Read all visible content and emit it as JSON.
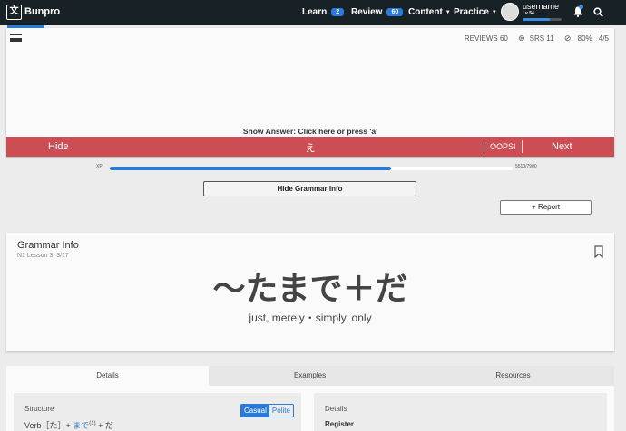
{
  "nav": {
    "logo_glyph": "文",
    "brand": "Bunpro",
    "learn_label": "Learn",
    "learn_count": "2",
    "review_label": "Review",
    "review_count": "60",
    "content_label": "Content",
    "practice_label": "Practice",
    "username": "username",
    "level": "Lv 54",
    "level_progress": 0.7
  },
  "review": {
    "reviews": "REVIEWS 60",
    "srs": "SRS 11",
    "accuracy": "80%",
    "progress": "4/5",
    "show_answer": "Show Answer: Click here or press 'a'",
    "hide_label": "Hide",
    "answer": "え",
    "oops_label": "OOPS!",
    "next_label": "Next"
  },
  "xp": {
    "label": "XP",
    "count": "5510/7900",
    "fraction": 0.6975
  },
  "buttons": {
    "hide_grammar": "Hide Grammar Info",
    "report": "+ Report"
  },
  "grammar": {
    "heading": "Grammar Info",
    "lesson": "N1 Lesson 3: 3/17",
    "point": "〜たまで＋だ",
    "meaning": "just, merely・simply, only"
  },
  "tabs": [
    "Details",
    "Examples",
    "Resources"
  ],
  "structure": {
    "label": "Structure",
    "casual": "Casual",
    "polite": "Polite",
    "verb": "Verb［た］+ ",
    "link": "まで",
    "sup": "(1)",
    "tail": " + だ"
  },
  "details": {
    "label": "Details",
    "register": "Register"
  },
  "colors": {
    "nav_bg": "#182126",
    "accent": "#2b7bd6",
    "answer_bar": "#cd4d55"
  }
}
